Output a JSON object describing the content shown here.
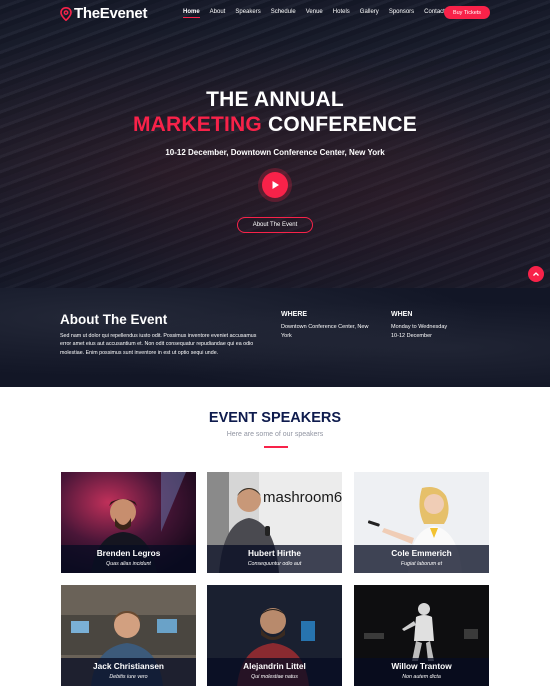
{
  "brand": {
    "name": "TheEvenet",
    "accent": "#f82249",
    "navy": "#0e1b4d"
  },
  "nav": {
    "items": [
      "Home",
      "About",
      "Speakers",
      "Schedule",
      "Venue",
      "Hotels",
      "Gallery",
      "Sponsors",
      "Contact"
    ],
    "active": "Home",
    "buy_label": "Buy Tickets"
  },
  "hero": {
    "line1": "THE ANNUAL",
    "line2_accent": "MARKETING",
    "line2_rest": " CONFERENCE",
    "subtitle": "10-12 December, Downtown Conference Center, New York",
    "about_button": "About The Event",
    "play_icon": "play-icon",
    "back_to_top_icon": "chevron-up-icon"
  },
  "about": {
    "title": "About The Event",
    "body": "Sed nam ut dolor qui repellendus iusto odit. Possimus inventore eveniet accusamus error amet eius aut accusantium et. Non odit consequatur repudiandae qui ea odio molestiae. Enim possimus sunt inventore in est ut optio sequi unde.",
    "where_label": "WHERE",
    "where_text": "Downtown Conference Center, New York",
    "when_label": "WHEN",
    "when_text_1": "Monday to Wednesday",
    "when_text_2": "10-12 December"
  },
  "speakers": {
    "title": "EVENT SPEAKERS",
    "subtitle": "Here are some of our speakers",
    "items": [
      {
        "name": "Brenden Legros",
        "role": "Quas alias incidunt"
      },
      {
        "name": "Hubert Hirthe",
        "role": "Consequuntur odio aut"
      },
      {
        "name": "Cole Emmerich",
        "role": "Fugiat laborum et"
      },
      {
        "name": "Jack Christiansen",
        "role": "Debitis iure vero"
      },
      {
        "name": "Alejandrin Littel",
        "role": "Qui molestiae natus"
      },
      {
        "name": "Willow Trantow",
        "role": "Non autem dicta"
      }
    ],
    "sign_text": "mashroom6"
  }
}
